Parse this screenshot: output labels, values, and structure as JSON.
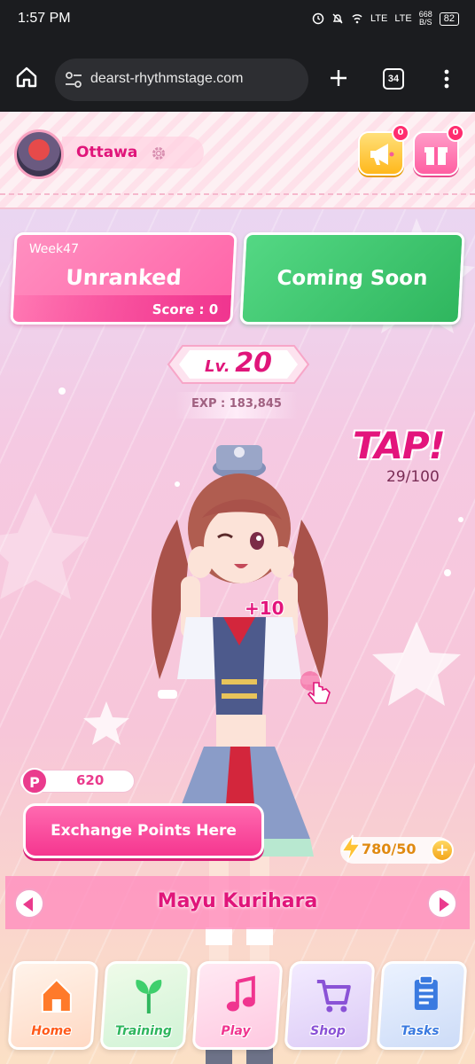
{
  "status_bar": {
    "time": "1:57 PM",
    "network_1": "LTE",
    "network_2": "LTE",
    "speed": "668",
    "speed_unit": "B/S",
    "battery": "82"
  },
  "browser": {
    "url": "dearst-rhythmstage.com",
    "tab_count": "34"
  },
  "player": {
    "name": "Ottawa"
  },
  "header_buttons": {
    "announce_badge": "0",
    "gift_badge": "0"
  },
  "ranking": {
    "week": "Week47",
    "status": "Unranked",
    "score": "Score : 0"
  },
  "event": {
    "label": "Coming Soon"
  },
  "level": {
    "prefix": "Lv.",
    "value": "20",
    "exp": "EXP : 183,845"
  },
  "tap": {
    "label": "TAP!",
    "count": "29/100",
    "gain": "+10"
  },
  "points": {
    "icon_letter": "P",
    "value": "620",
    "exchange_label": "Exchange Points Here"
  },
  "energy": {
    "value": "780/50",
    "plus": "+"
  },
  "character": {
    "name": "Mayu Kurihara"
  },
  "nav": [
    {
      "label": "Home",
      "color": "#ff7a2a",
      "icon": "home-icon"
    },
    {
      "label": "Training",
      "color": "#2fb65e",
      "icon": "sprout-icon"
    },
    {
      "label": "Play",
      "color": "#f0358f",
      "icon": "music-note-icon"
    },
    {
      "label": "Shop",
      "color": "#8a52d6",
      "icon": "cart-icon"
    },
    {
      "label": "Tasks",
      "color": "#3a7ae0",
      "icon": "clipboard-icon"
    }
  ],
  "colors": {
    "accent_pink": "#e0157a",
    "green": "#2fb65e",
    "gold": "#ffb81c"
  }
}
